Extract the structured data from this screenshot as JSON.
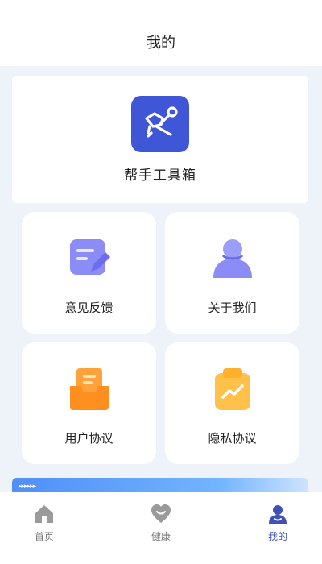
{
  "header": {
    "title": "我的"
  },
  "toolbox": {
    "label": "帮手工具箱",
    "icon": "wrench-tool-icon",
    "color": "#3f56d6"
  },
  "grid": {
    "feedback": {
      "label": "意见反馈",
      "icon": "feedback-edit-icon",
      "color": "#8c8cf7"
    },
    "about": {
      "label": "关于我们",
      "icon": "user-icon",
      "color": "#8c8cf7"
    },
    "user_agreement": {
      "label": "用户协议",
      "icon": "inbox-document-icon",
      "color": "#ffa23a"
    },
    "privacy_agreement": {
      "label": "隐私协议",
      "icon": "clipboard-chart-icon",
      "color": "#ffc14a"
    }
  },
  "banner": {
    "arrows": "▸▸▸▸▸▸"
  },
  "tabs": [
    {
      "label": "首页",
      "icon": "home-icon",
      "active": false
    },
    {
      "label": "健康",
      "icon": "heart-smile-icon",
      "active": false
    },
    {
      "label": "我的",
      "icon": "profile-icon",
      "active": true
    }
  ],
  "colors": {
    "accent": "#3f51b5",
    "inactive": "#9a9a9a",
    "background": "#eef3f9"
  }
}
